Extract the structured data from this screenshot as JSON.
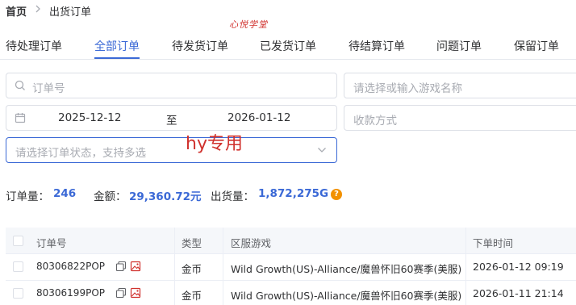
{
  "breadcrumb": {
    "home": "首页",
    "separator": ">",
    "current": "出货订单"
  },
  "watermark": "心悦学堂",
  "tabs": [
    {
      "label": "待处理订单",
      "active": false
    },
    {
      "label": "全部订单",
      "active": true
    },
    {
      "label": "待发货订单",
      "active": false
    },
    {
      "label": "已发货订单",
      "active": false
    },
    {
      "label": "待结算订单",
      "active": false
    },
    {
      "label": "问题订单",
      "active": false
    },
    {
      "label": "保留订单",
      "active": false
    }
  ],
  "filters": {
    "order_no_placeholder": "订单号",
    "game_placeholder": "请选择或输入游戏名称",
    "date_start": "2025-12-12",
    "date_separator": "至",
    "date_end": "2026-01-12",
    "payment_placeholder": "收款方式",
    "status_placeholder": "请选择订单状态，支持多选"
  },
  "overlay_text": "hy专用",
  "stats": {
    "order_count_label": "订单量：",
    "order_count": "246",
    "amount_label": "金额：",
    "amount": "29,360.72元",
    "shipped_label": "出货量：",
    "shipped": "1,872,275G",
    "help_icon": "?"
  },
  "table": {
    "headers": [
      "订单号",
      "类型",
      "区服游戏",
      "下单时间"
    ],
    "rows": [
      {
        "order_no": "80306822POP",
        "type": "金币",
        "server_game": "Wild Growth(US)-Alliance/魔兽怀旧60赛季(美服)",
        "time": "2026-01-12 09:19"
      },
      {
        "order_no": "80306199POP",
        "type": "金币",
        "server_game": "Wild Growth(US)-Alliance/魔兽怀旧60赛季(美服)",
        "time": "2026-01-11 21:14"
      }
    ]
  },
  "colors": {
    "accent": "#3b69d6",
    "warning": "#f29100",
    "watermark": "#d0312d"
  }
}
